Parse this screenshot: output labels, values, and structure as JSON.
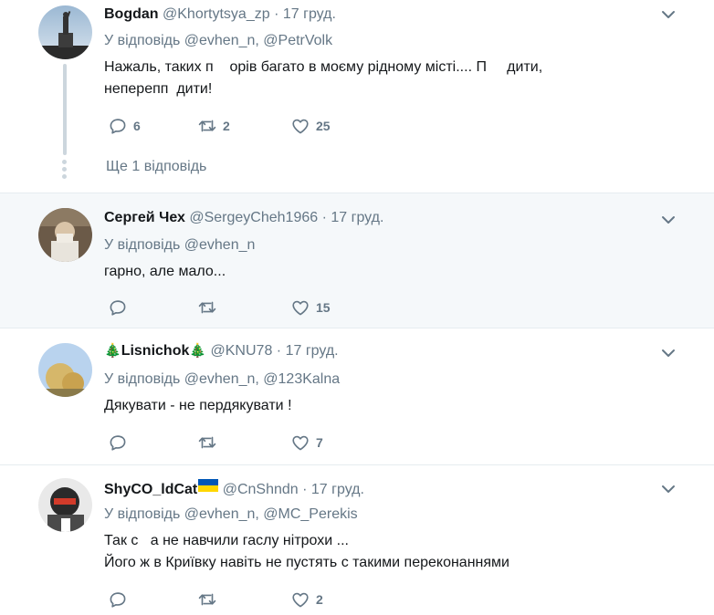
{
  "tweets": [
    {
      "name": "Bogdan",
      "handle": "@Khortytsya_zp",
      "dot": "·",
      "time": "17 груд.",
      "reply_prefix": "У відповідь",
      "reply_mentions": "@evhen_n, @PetrVolk",
      "text_line1": "Нажаль, таких п    орів багато в моєму рідному місті.... П     дити,",
      "text_line2": "неперепп  дити!",
      "reply_count": "6",
      "retweet_count": "2",
      "like_count": "25",
      "more_replies": "Ще 1 відповідь"
    },
    {
      "name": "Сергей Чех",
      "handle": "@SergeyCheh1966",
      "dot": "·",
      "time": "17 груд.",
      "reply_prefix": "У відповідь",
      "reply_mentions": "@evhen_n",
      "text_line1": "гарно, але мало...",
      "reply_count": "",
      "retweet_count": "",
      "like_count": "15"
    },
    {
      "name_pre_emoji": "🎄",
      "name": "Lisnichok",
      "name_post_emoji": "🎄",
      "handle": "@KNU78",
      "dot": "·",
      "time": "17 груд.",
      "reply_prefix": "У відповідь",
      "reply_mentions": "@evhen_n, @123Kalna",
      "text_line1": "Дякувати - не пердякувати !",
      "reply_count": "",
      "retweet_count": "",
      "like_count": "7"
    },
    {
      "name": "ShyCO_ldCat",
      "name_flag": "🇺🇦",
      "handle": "@CnShndn",
      "dot": "·",
      "time": "17 груд.",
      "reply_prefix": "У відповідь",
      "reply_mentions": "@evhen_n, @MC_Perekis",
      "text_line1": "Так с   а не навчили гаслу нітрохи ...",
      "text_line2": "Його ж в Криївку навіть не пустять с такими переконаннями",
      "reply_count": "",
      "retweet_count": "",
      "like_count": "2"
    }
  ],
  "colors": {
    "secondary_text": "#657786",
    "primary_text": "#14171a",
    "highlight_bg": "#f5f8fa",
    "divider": "#e6ecf0",
    "flag_blue": "#0057b7",
    "flag_yellow": "#ffd700"
  },
  "icons": [
    "reply-icon",
    "retweet-icon",
    "like-icon",
    "chevron-down-icon"
  ]
}
